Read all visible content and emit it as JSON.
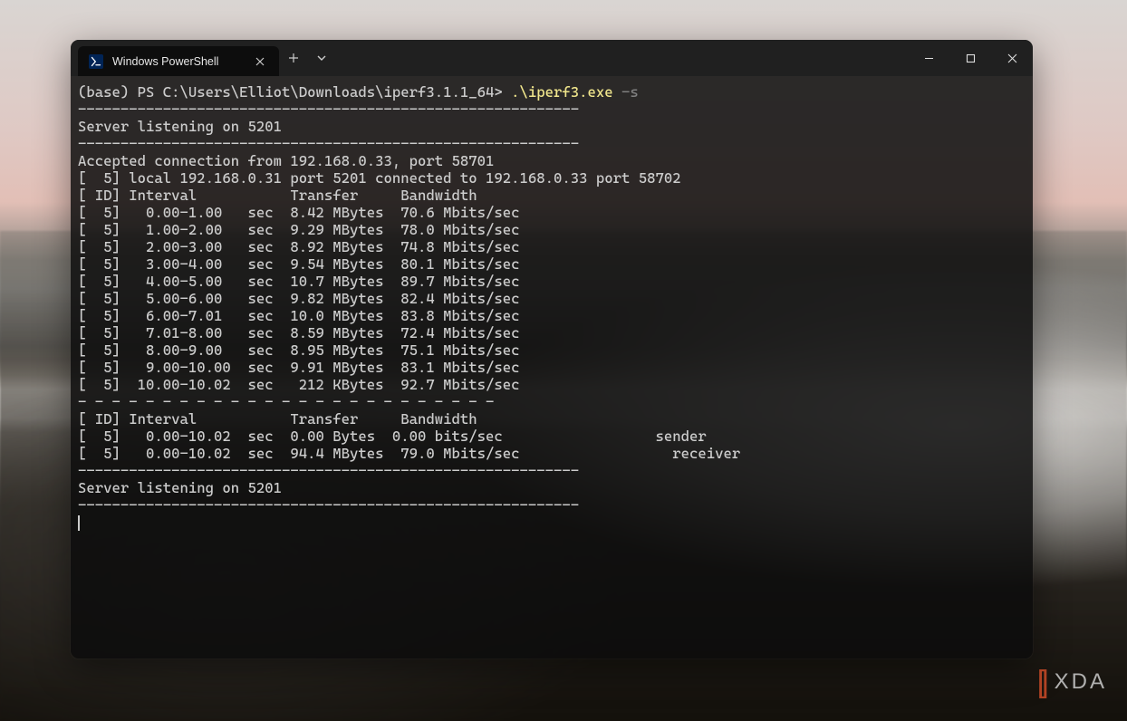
{
  "tab": {
    "title": "Windows PowerShell"
  },
  "prompt": {
    "base": "(base) PS C:\\Users\\Elliot\\Downloads\\iperf3.1.1_64> ",
    "command": ".\\iperf3.exe",
    "arg": " -s"
  },
  "output": {
    "sep1": "-----------------------------------------------------------",
    "listen1": "Server listening on 5201",
    "sep2": "-----------------------------------------------------------",
    "accepted": "Accepted connection from 192.168.0.33, port 58701",
    "local": "[  5] local 192.168.0.31 port 5201 connected to 192.168.0.33 port 58702",
    "hdr1": "[ ID] Interval           Transfer     Bandwidth",
    "r0": "[  5]   0.00-1.00   sec  8.42 MBytes  70.6 Mbits/sec",
    "r1": "[  5]   1.00-2.00   sec  9.29 MBytes  78.0 Mbits/sec",
    "r2": "[  5]   2.00-3.00   sec  8.92 MBytes  74.8 Mbits/sec",
    "r3": "[  5]   3.00-4.00   sec  9.54 MBytes  80.1 Mbits/sec",
    "r4": "[  5]   4.00-5.00   sec  10.7 MBytes  89.7 Mbits/sec",
    "r5": "[  5]   5.00-6.00   sec  9.82 MBytes  82.4 Mbits/sec",
    "r6": "[  5]   6.00-7.01   sec  10.0 MBytes  83.8 Mbits/sec",
    "r7": "[  5]   7.01-8.00   sec  8.59 MBytes  72.4 Mbits/sec",
    "r8": "[  5]   8.00-9.00   sec  8.95 MBytes  75.1 Mbits/sec",
    "r9": "[  5]   9.00-10.00  sec  9.91 MBytes  83.1 Mbits/sec",
    "r10": "[  5]  10.00-10.02  sec   212 KBytes  92.7 Mbits/sec",
    "dash": "- - - - - - - - - - - - - - - - - - - - - - - - -",
    "hdr2": "[ ID] Interval           Transfer     Bandwidth",
    "sum1": "[  5]   0.00-10.02  sec  0.00 Bytes  0.00 bits/sec                  sender",
    "sum2": "[  5]   0.00-10.02  sec  94.4 MBytes  79.0 Mbits/sec                  receiver",
    "sep3": "-----------------------------------------------------------",
    "listen2": "Server listening on 5201",
    "sep4": "-----------------------------------------------------------"
  },
  "watermark": {
    "text": "XDA"
  }
}
